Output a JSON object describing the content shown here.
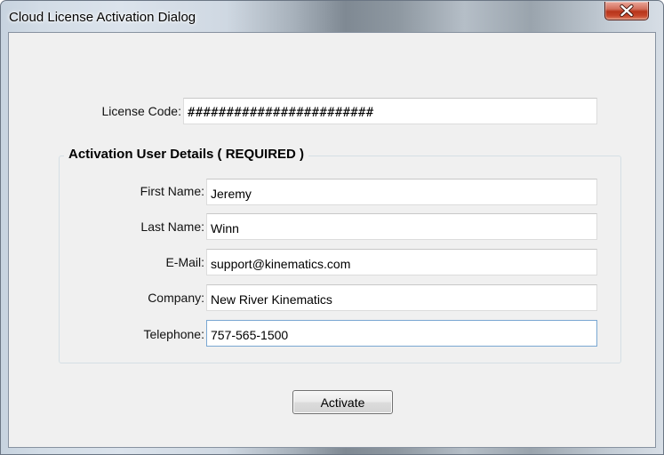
{
  "window": {
    "title": "Cloud License Activation Dialog",
    "close_icon": "close-x-icon"
  },
  "license": {
    "label": "License Code:",
    "value": "########################"
  },
  "activation_group": {
    "legend": "Activation User Details ( REQUIRED )",
    "fields": {
      "first_name": {
        "label": "First Name:",
        "value": "Jeremy"
      },
      "last_name": {
        "label": "Last Name:",
        "value": "Winn"
      },
      "email": {
        "label": "E-Mail:",
        "value": "support@kinematics.com"
      },
      "company": {
        "label": "Company:",
        "value": "New River Kinematics"
      },
      "telephone": {
        "label": "Telephone:",
        "value": "757-565-1500"
      }
    }
  },
  "actions": {
    "activate_label": "Activate"
  },
  "colors": {
    "close_button": "#c7472c",
    "dialog_background": "#f0f0f0",
    "focus_border": "#7aa7d2"
  }
}
